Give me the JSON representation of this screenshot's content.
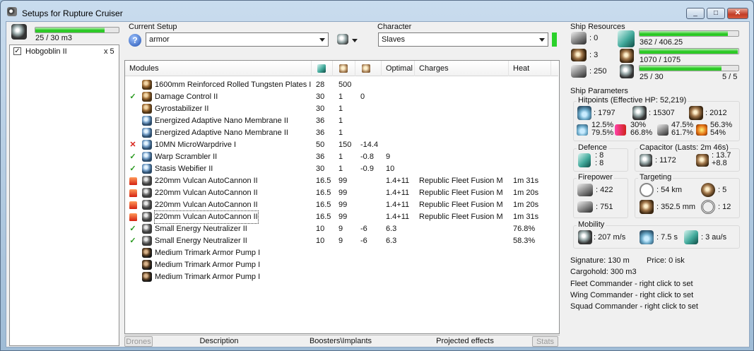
{
  "window": {
    "title": "Setups for Rupture Cruiser",
    "controls": {
      "minimize": "_",
      "maximize": "□",
      "close": "✕"
    }
  },
  "drones_panel": {
    "bandwidth": "25 / 30 m3",
    "bandwidth_fraction": 0.83,
    "items": [
      {
        "name": "Hobgoblin II",
        "count": "x 5",
        "checked": true
      }
    ]
  },
  "setup": {
    "current_setup_label": "Current Setup",
    "current_setup_value": "armor",
    "character_label": "Character",
    "character_value": "Slaves"
  },
  "modules": {
    "columns": {
      "name": "Modules",
      "cpu_icon": "cpu-icon",
      "power_icon": "powergrid-icon",
      "cap_icon": "capacitor-icon",
      "optimal": "Optimal",
      "charges": "Charges",
      "heat": "Heat"
    },
    "rows": [
      {
        "status": "",
        "icon": "brown",
        "name": "1600mm Reinforced Rolled Tungsten Plates I",
        "cpu": "28",
        "pg": "500",
        "cap": "",
        "optimal": "",
        "charges": "",
        "heat": ""
      },
      {
        "status": "ok",
        "icon": "brown",
        "name": "Damage Control II",
        "cpu": "30",
        "pg": "1",
        "cap": "0",
        "optimal": "",
        "charges": "",
        "heat": ""
      },
      {
        "status": "",
        "icon": "brown",
        "name": "Gyrostabilizer II",
        "cpu": "30",
        "pg": "1",
        "cap": "",
        "optimal": "",
        "charges": "",
        "heat": ""
      },
      {
        "status": "",
        "icon": "blue",
        "name": "Energized Adaptive Nano Membrane II",
        "cpu": "36",
        "pg": "1",
        "cap": "",
        "optimal": "",
        "charges": "",
        "heat": ""
      },
      {
        "status": "",
        "icon": "blue",
        "name": "Energized Adaptive Nano Membrane II",
        "cpu": "36",
        "pg": "1",
        "cap": "",
        "optimal": "",
        "charges": "",
        "heat": ""
      },
      {
        "status": "x",
        "icon": "blue",
        "name": "10MN MicroWarpdrive I",
        "cpu": "50",
        "pg": "150",
        "cap": "-14.4",
        "optimal": "",
        "charges": "",
        "heat": ""
      },
      {
        "status": "ok",
        "icon": "blue",
        "name": "Warp Scrambler II",
        "cpu": "36",
        "pg": "1",
        "cap": "-0.8",
        "optimal": "9",
        "charges": "",
        "heat": ""
      },
      {
        "status": "ok",
        "icon": "blue",
        "name": "Stasis Webifier II",
        "cpu": "30",
        "pg": "1",
        "cap": "-0.9",
        "optimal": "10",
        "charges": "",
        "heat": ""
      },
      {
        "status": "heat",
        "icon": "grey",
        "name": "220mm Vulcan AutoCannon II",
        "cpu": "16.5",
        "pg": "99",
        "cap": "",
        "optimal": "1.4+11",
        "charges": "Republic Fleet Fusion M",
        "heat": "1m 31s"
      },
      {
        "status": "heat",
        "icon": "grey",
        "name": "220mm Vulcan AutoCannon II",
        "cpu": "16.5",
        "pg": "99",
        "cap": "",
        "optimal": "1.4+11",
        "charges": "Republic Fleet Fusion M",
        "heat": "1m 20s"
      },
      {
        "status": "heat",
        "icon": "grey",
        "name": "220mm Vulcan AutoCannon II",
        "cpu": "16.5",
        "pg": "99",
        "cap": "",
        "optimal": "1.4+11",
        "charges": "Republic Fleet Fusion M",
        "heat": "1m 20s"
      },
      {
        "status": "heat",
        "icon": "grey",
        "name": "220mm Vulcan AutoCannon II",
        "cpu": "16.5",
        "pg": "99",
        "cap": "",
        "optimal": "1.4+11",
        "charges": "Republic Fleet Fusion M",
        "heat": "1m 31s",
        "selected": true
      },
      {
        "status": "ok",
        "icon": "grey",
        "name": "Small Energy Neutralizer II",
        "cpu": "10",
        "pg": "9",
        "cap": "-6",
        "optimal": "6.3",
        "charges": "",
        "heat": "76.8%"
      },
      {
        "status": "ok",
        "icon": "grey",
        "name": "Small Energy Neutralizer II",
        "cpu": "10",
        "pg": "9",
        "cap": "-6",
        "optimal": "6.3",
        "charges": "",
        "heat": "58.3%"
      },
      {
        "status": "",
        "icon": "dark",
        "name": "Medium Trimark Armor Pump I",
        "cpu": "",
        "pg": "",
        "cap": "",
        "optimal": "",
        "charges": "",
        "heat": ""
      },
      {
        "status": "",
        "icon": "dark",
        "name": "Medium Trimark Armor Pump I",
        "cpu": "",
        "pg": "",
        "cap": "",
        "optimal": "",
        "charges": "",
        "heat": ""
      },
      {
        "status": "",
        "icon": "dark",
        "name": "Medium Trimark Armor Pump I",
        "cpu": "",
        "pg": "",
        "cap": "",
        "optimal": "",
        "charges": "",
        "heat": ""
      }
    ]
  },
  "bottom_tabs": [
    "Drones",
    "Description",
    "Boosters\\Implants",
    "Projected effects",
    "Stats"
  ],
  "resources": {
    "title": "Ship Resources",
    "hardpoints_turret": ": 0",
    "hardpoints_launcher": ": 3",
    "drone_bay": ": 250",
    "cpu": "362 / 406.25",
    "cpu_fraction": 0.89,
    "powergrid": "1070 / 1075",
    "powergrid_fraction": 0.995,
    "drone_bandwidth": "25 / 30",
    "drone_bandwidth_fraction": 0.83,
    "drones_active": "5 / 5"
  },
  "parameters": {
    "title": "Ship Parameters",
    "hitpoints_title": "Hitpoints (Effective HP: 52,219)",
    "shield_hp": ": 1797",
    "armor_hp": ": 15307",
    "structure_hp": ": 2012",
    "resists": [
      {
        "top": "12.5%",
        "bottom": "79.5%"
      },
      {
        "top": "30%",
        "bottom": "66.8%"
      },
      {
        "top": "47.5%",
        "bottom": "61.7%"
      },
      {
        "top": "56.3%",
        "bottom": "54%"
      }
    ],
    "defence_title": "Defence",
    "defence_a": ": 8",
    "defence_b": ": 8",
    "capacitor_title": "Capacitor (Lasts: 2m 46s)",
    "capacitor_amount": ": 1172",
    "capacitor_a": ": 13.7",
    "capacitor_b": "+8.8",
    "firepower_title": "Firepower",
    "dps": ": 422",
    "volley": ": 751",
    "targeting_title": "Targeting",
    "range": ": 54 km",
    "targets": ": 5",
    "scan_res": ": 352.5 mm",
    "sensor": ": 12",
    "mobility_title": "Mobility",
    "speed": ": 207 m/s",
    "align": ": 7.5 s",
    "warp": ": 3 au/s"
  },
  "footer_info": {
    "signature": "Signature: 130 m",
    "price": "Price: 0 isk",
    "cargohold": "Cargohold: 300 m3",
    "fleet": "Fleet Commander - right click to set",
    "wing": "Wing Commander - right click to set",
    "squad": "Squad Commander - right click to set"
  },
  "colors": {
    "accent_green": "#23c41e",
    "error_red": "#d8231a",
    "heat_orange": "#e0501a"
  }
}
